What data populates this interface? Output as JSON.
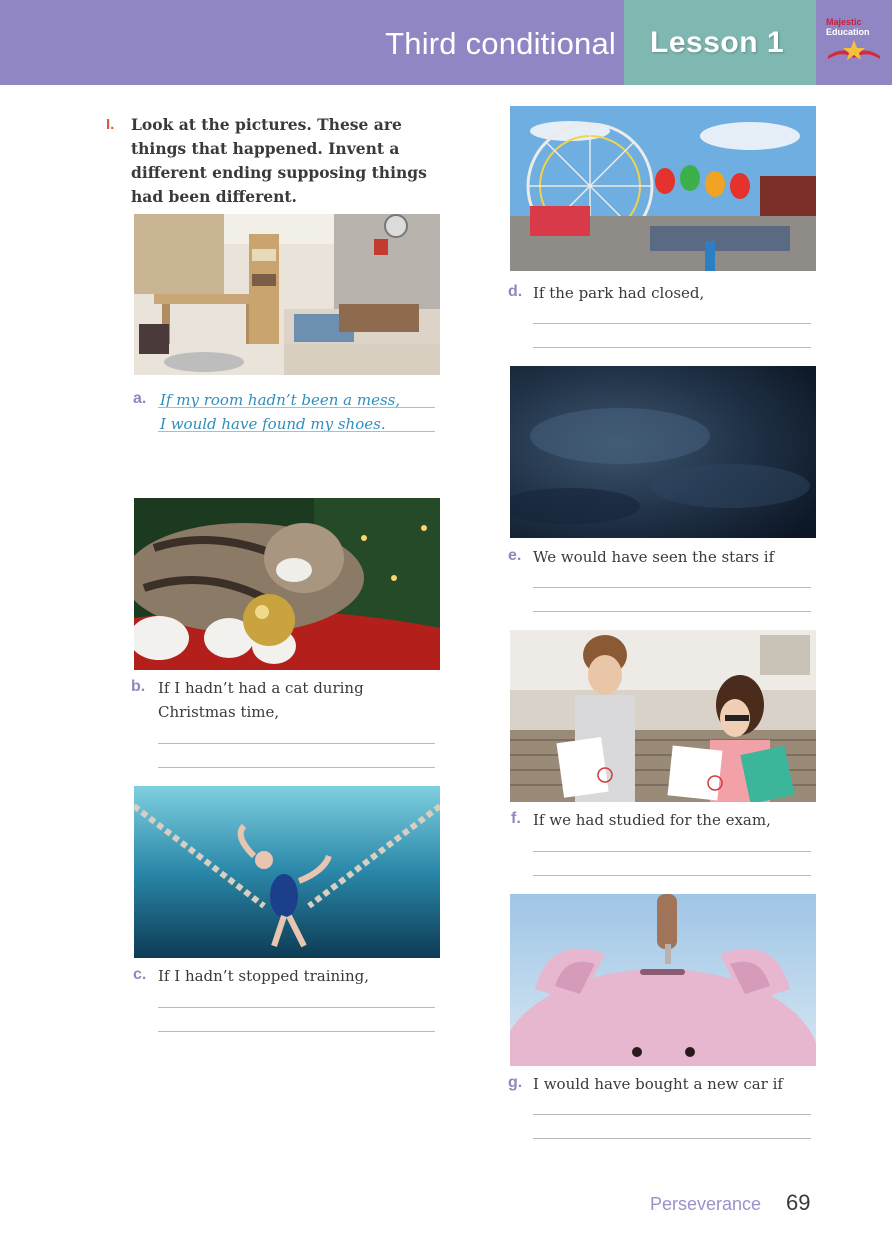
{
  "header": {
    "topic": "Third conditional",
    "lesson": "Lesson 1",
    "logo_line1": "Majestic",
    "logo_line2": "Education"
  },
  "exercise": {
    "number": "I.",
    "instruction": "Look at the pictures. These are things that happened. Invent a different ending supposing things had been different."
  },
  "items": [
    {
      "label": "a.",
      "prompt": "",
      "answer_line1": "If my room hadn’t been a mess,",
      "answer_line2": "I would have found my shoes.",
      "image": "messy-bedroom-photo"
    },
    {
      "label": "b.",
      "prompt_line1": "If I hadn’t had a cat during",
      "prompt_line2": "Christmas time,",
      "image": "cat-christmas-photo"
    },
    {
      "label": "c.",
      "prompt": "If I hadn’t stopped training,",
      "image": "swimmer-pool-photo"
    },
    {
      "label": "d.",
      "prompt": "If the park had closed,",
      "image": "amusement-park-photo"
    },
    {
      "label": "e.",
      "prompt": "We would have seen the stars if",
      "image": "stormy-sky-photo"
    },
    {
      "label": "f.",
      "prompt": "If we had studied for the exam,",
      "image": "students-exam-photo"
    },
    {
      "label": "g.",
      "prompt": "I would have bought a new car if",
      "image": "piggy-bank-photo"
    }
  ],
  "footer": {
    "value": "Perseverance",
    "page": "69"
  },
  "colors": {
    "header_purple": "#9186c4",
    "lesson_teal": "#7eb8b0",
    "label_purple": "#8f87c0",
    "answer_blue": "#2f8fbf",
    "exercise_orange": "#e05a3a"
  }
}
